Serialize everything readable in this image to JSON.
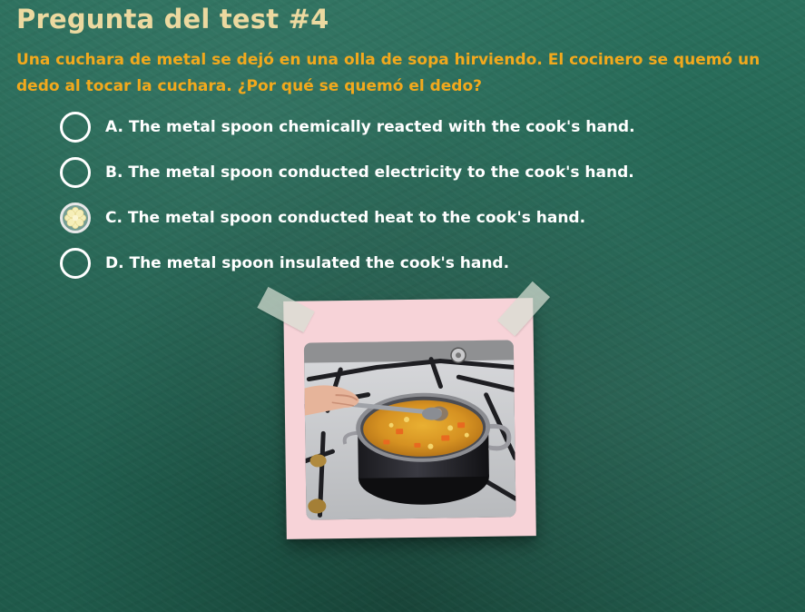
{
  "title": "Pregunta del test #4",
  "question": "Una cuchara de metal se dejó en una olla de sopa hirviendo. El cocinero se quemó un dedo al tocar la cuchara. ¿Por qué se quemó el dedo?",
  "options": [
    {
      "label": "A. The metal spoon chemically reacted with the cook's hand.",
      "selected": false
    },
    {
      "label": "B. The metal spoon conducted electricity to the cook's hand.",
      "selected": false
    },
    {
      "label": "C. The metal spoon conducted heat to the cook's hand.",
      "selected": true
    },
    {
      "label": "D. The metal spoon insulated the cook's hand.",
      "selected": false
    }
  ],
  "icons": {
    "radio": "radio-circle-icon",
    "selected_mark": "flower-mark-icon"
  },
  "colors": {
    "title": "#ecd9a0",
    "question": "#f2a91d",
    "option_text": "#ffffff",
    "board": "#236352",
    "note_paper": "#f7d3d8"
  }
}
